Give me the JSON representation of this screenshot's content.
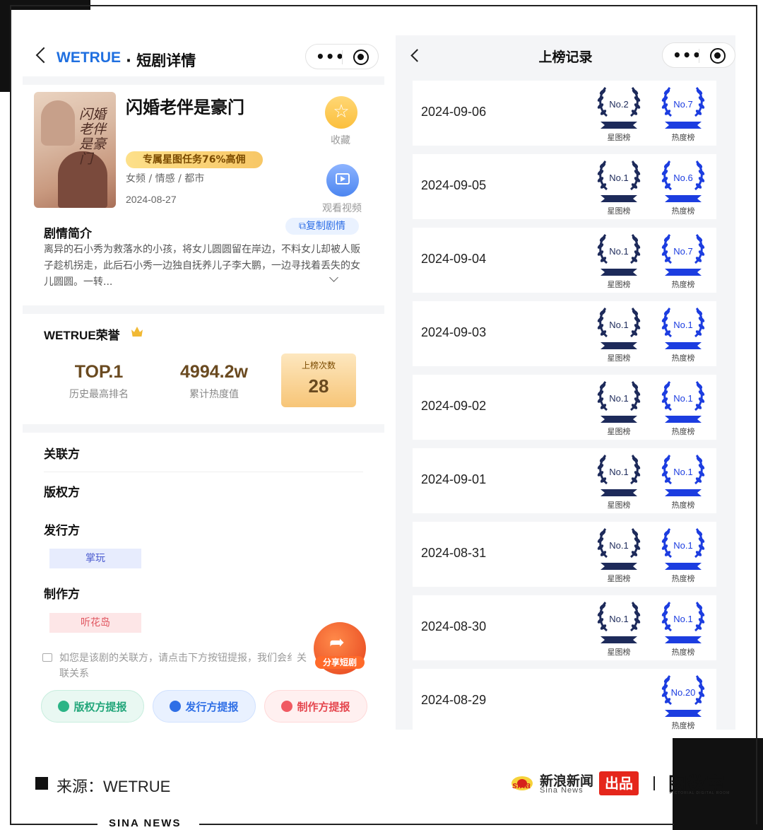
{
  "left": {
    "header": {
      "brand": "WETRUE",
      "title": "· 短剧详情"
    },
    "drama": {
      "title": "闪婚老伴是豪门",
      "poster_title": "闪婚老伴是豪门",
      "promo": "专属星图任务76%高佣",
      "genre": "女频 / 情感 / 都市",
      "date": "2024-08-27",
      "favorite_label": "收藏",
      "video_label": "观看视频",
      "synopsis_heading": "剧情简介",
      "copy_label": "复制剧情",
      "synopsis": "离异的石小秀为救落水的小孩，将女儿圆圆留在岸边，不料女儿却被人贩子趁机拐走，此后石小秀一边独自抚养儿子李大鹏，一边寻找着丢失的女儿圆圆。一转..."
    },
    "honor": {
      "title": "WETRUE荣誉",
      "top_value": "TOP.1",
      "top_label": "历史最高排名",
      "heat_value": "4994.2w",
      "heat_label": "累计热度值",
      "count_label": "上榜次数",
      "count_value": "28"
    },
    "parties": {
      "related": "关联方",
      "copyright": "版权方",
      "publisher": "发行方",
      "publisher_tag": "掌玩",
      "producer": "制作方",
      "producer_tag": "听花岛",
      "note": "如您是该剧的关联方，请点击下方按钮提报，我们会纟关联关系",
      "share_label": "分享短剧",
      "report_copyright": "版权方提报",
      "report_publisher": "发行方提报",
      "report_producer": "制作方提报"
    }
  },
  "right": {
    "title": "上榜记录",
    "star_list_label": "星图榜",
    "heat_list_label": "热度榜",
    "records": [
      {
        "date": "2024-09-06",
        "star": "No.2",
        "heat": "No.7"
      },
      {
        "date": "2024-09-05",
        "star": "No.1",
        "heat": "No.6"
      },
      {
        "date": "2024-09-04",
        "star": "No.1",
        "heat": "No.7"
      },
      {
        "date": "2024-09-03",
        "star": "No.1",
        "heat": "No.1"
      },
      {
        "date": "2024-09-02",
        "star": "No.1",
        "heat": "No.1"
      },
      {
        "date": "2024-09-01",
        "star": "No.1",
        "heat": "No.1"
      },
      {
        "date": "2024-08-31",
        "star": "No.1",
        "heat": "No.1"
      },
      {
        "date": "2024-08-30",
        "star": "No.1",
        "heat": "No.1"
      },
      {
        "date": "2024-08-29",
        "star": "",
        "heat": "No.20"
      }
    ]
  },
  "footer": {
    "source": "来源：WETRUE",
    "sina_logo": "sina",
    "sina_cn": "新浪新闻",
    "sina_en": "Sina News",
    "chupin": "出品",
    "datalab": "图数室",
    "datalab_sub": "PICTORIAL DIGITAL ROOM",
    "sina_news_label": "SINA NEWS"
  },
  "colors": {
    "brand_blue": "#1f6fe0",
    "star_badge": "#1d2a5a",
    "heat_badge": "#1c3de0",
    "accent_red": "#e5261b"
  },
  "icons": [
    "back-chevron-icon",
    "more-dots-icon",
    "target-icon",
    "star-icon",
    "video-icon",
    "copy-icon",
    "chevron-down-icon",
    "crown-icon",
    "share-icon",
    "laurel-badge-icon"
  ]
}
